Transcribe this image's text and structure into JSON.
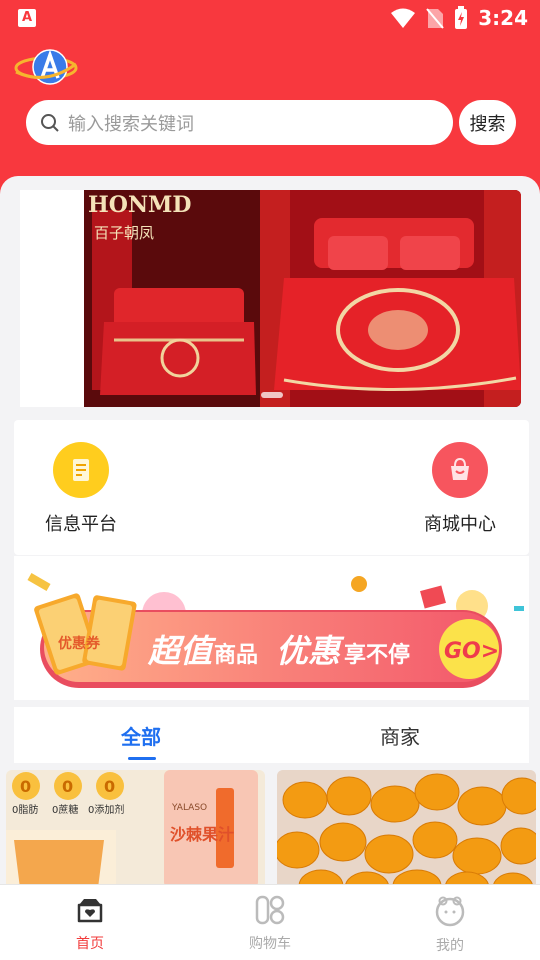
{
  "status_bar": {
    "time": "3:24"
  },
  "search": {
    "placeholder": "输入搜索关键词",
    "button_label": "搜索"
  },
  "nav": [
    {
      "label": "信息平台",
      "icon": "document-icon"
    },
    {
      "label": "商城中心",
      "icon": "shopping-bag-icon"
    }
  ],
  "promo": {
    "coupon_text": "优惠券",
    "slogan_main": "超值",
    "slogan_part2": "商品",
    "slogan_part3": "优惠",
    "slogan_part4": "享不停",
    "go_label": "GO>"
  },
  "banner": {
    "brand_text": "HONMD",
    "side_text": "百子朝凤"
  },
  "tabs": [
    {
      "label": "全部",
      "active": true
    },
    {
      "label": "商家",
      "active": false
    }
  ],
  "products": [
    {
      "badges": [
        "0脂肪",
        "0蔗糖",
        "0添加剂"
      ],
      "brand": "YALASO",
      "product_text": "沙棘果汁"
    },
    {
      "image": "sea-buckthorn-berries"
    }
  ],
  "bottom_nav": [
    {
      "label": "首页",
      "icon": "home-icon",
      "active": true
    },
    {
      "label": "购物车",
      "icon": "cart-icon",
      "active": false
    },
    {
      "label": "我的",
      "icon": "profile-icon",
      "active": false
    }
  ],
  "colors": {
    "header_red": "#f8383e",
    "active_blue": "#1f6ff0",
    "active_red": "#f23b3b"
  }
}
